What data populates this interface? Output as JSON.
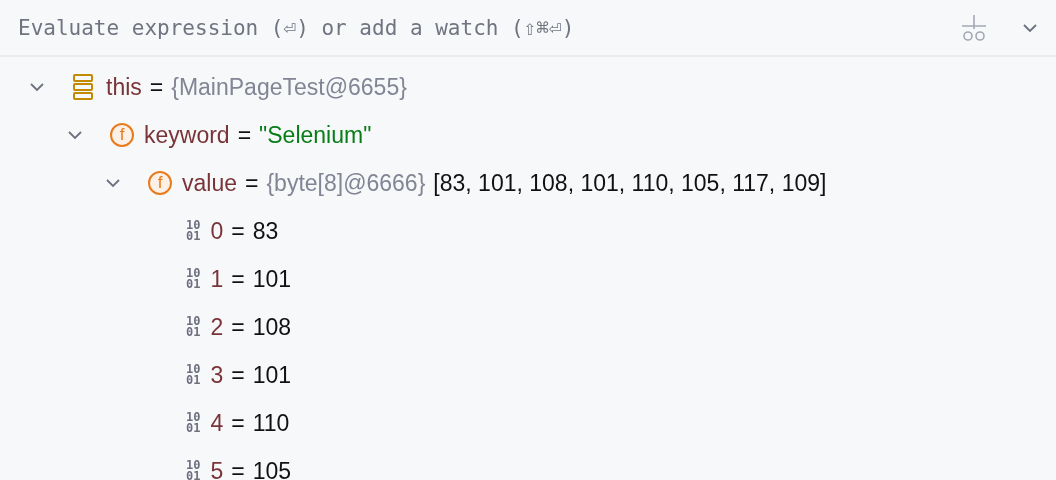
{
  "watch_bar": {
    "placeholder": "Evaluate expression (⏎) or add a watch (⇧⌘⏎)"
  },
  "tree": [
    {
      "name": "this",
      "kind": "object",
      "eq": "=",
      "type": "{MainPageTest@6655}",
      "expanded": true,
      "children": [
        {
          "name": "keyword",
          "kind": "field",
          "glyph": [
            "f"
          ],
          "eq": "=",
          "value": {
            "kind": "string",
            "text": "\"Selenium\""
          },
          "expanded": true,
          "children": [
            {
              "name": "value",
              "kind": "field",
              "glyph": [
                "f"
              ],
              "eq": "=",
              "type": "{byte[8]@6666}",
              "value": {
                "kind": "plain",
                "text": "[83, 101, 108, 101, 110, 105, 117, 109]"
              },
              "expanded": true,
              "children": [
                {
                  "name": "0",
                  "kind": "primitive",
                  "glyph": [
                    "10",
                    "01"
                  ],
                  "eq": "=",
                  "value": {
                    "kind": "plain",
                    "text": "83"
                  }
                },
                {
                  "name": "1",
                  "kind": "primitive",
                  "glyph": [
                    "10",
                    "01"
                  ],
                  "eq": "=",
                  "value": {
                    "kind": "plain",
                    "text": "101"
                  }
                },
                {
                  "name": "2",
                  "kind": "primitive",
                  "glyph": [
                    "10",
                    "01"
                  ],
                  "eq": "=",
                  "value": {
                    "kind": "plain",
                    "text": "108"
                  }
                },
                {
                  "name": "3",
                  "kind": "primitive",
                  "glyph": [
                    "10",
                    "01"
                  ],
                  "eq": "=",
                  "value": {
                    "kind": "plain",
                    "text": "101"
                  }
                },
                {
                  "name": "4",
                  "kind": "primitive",
                  "glyph": [
                    "10",
                    "01"
                  ],
                  "eq": "=",
                  "value": {
                    "kind": "plain",
                    "text": "110"
                  }
                },
                {
                  "name": "5",
                  "kind": "primitive",
                  "glyph": [
                    "10",
                    "01"
                  ],
                  "eq": "=",
                  "value": {
                    "kind": "plain",
                    "text": "105"
                  }
                }
              ]
            }
          ]
        }
      ]
    }
  ]
}
